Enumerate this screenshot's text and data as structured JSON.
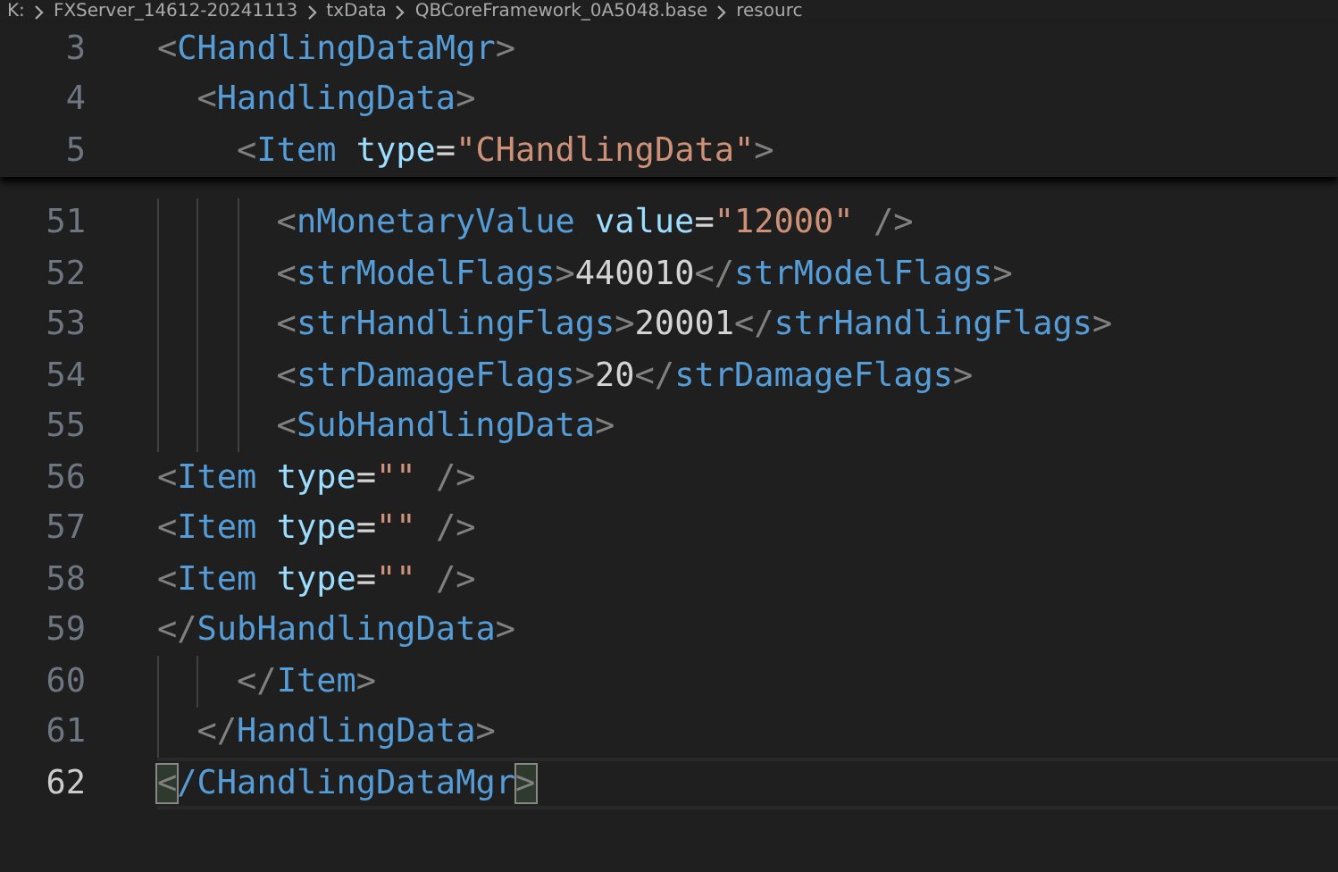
{
  "breadcrumb": [
    "K:",
    "FXServer_14612-20241113",
    "txData",
    "QBCoreFramework_0A5048.base",
    "resourc"
  ],
  "sticky_lines": [
    {
      "number": "3",
      "current": false,
      "tokens": [
        {
          "kind": "punct",
          "text": "<"
        },
        {
          "kind": "tag",
          "text": "CHandlingDataMgr"
        },
        {
          "kind": "punct",
          "text": ">"
        }
      ]
    },
    {
      "number": "4",
      "current": false,
      "guides": [
        false
      ],
      "tokens": [
        {
          "kind": "punct",
          "text": "<"
        },
        {
          "kind": "tag",
          "text": "HandlingData"
        },
        {
          "kind": "punct",
          "text": ">"
        }
      ]
    },
    {
      "number": "5",
      "current": false,
      "guides": [
        false,
        false
      ],
      "tokens": [
        {
          "kind": "punct",
          "text": "<"
        },
        {
          "kind": "tag",
          "text": "Item"
        },
        {
          "kind": "attr",
          "text": "type"
        },
        {
          "kind": "text",
          "text": "="
        },
        {
          "kind": "string",
          "text": "\"CHandlingData\""
        },
        {
          "kind": "punct",
          "text": ">"
        }
      ]
    }
  ],
  "lines": [
    {
      "number": "51",
      "current": false,
      "guides": [
        true,
        true,
        true
      ],
      "tokens": [
        {
          "kind": "punct",
          "text": "<"
        },
        {
          "kind": "tag",
          "text": "nMonetaryValue"
        },
        {
          "kind": "attr",
          "text": "value"
        },
        {
          "kind": "text",
          "text": "="
        },
        {
          "kind": "string",
          "text": "\"12000\""
        },
        {
          "kind": "selfclose",
          "text": "/>"
        }
      ]
    },
    {
      "number": "52",
      "current": false,
      "guides": [
        true,
        true,
        true
      ],
      "tokens": [
        {
          "kind": "punct",
          "text": "<"
        },
        {
          "kind": "tag",
          "text": "strModelFlags"
        },
        {
          "kind": "punct",
          "text": ">"
        },
        {
          "kind": "text",
          "text": "440010"
        },
        {
          "kind": "punct",
          "text": "</"
        },
        {
          "kind": "tag",
          "text": "strModelFlags"
        },
        {
          "kind": "punct",
          "text": ">"
        }
      ]
    },
    {
      "number": "53",
      "current": false,
      "guides": [
        true,
        true,
        true
      ],
      "tokens": [
        {
          "kind": "punct",
          "text": "<"
        },
        {
          "kind": "tag",
          "text": "strHandlingFlags"
        },
        {
          "kind": "punct",
          "text": ">"
        },
        {
          "kind": "text",
          "text": "20001"
        },
        {
          "kind": "punct",
          "text": "</"
        },
        {
          "kind": "tag",
          "text": "strHandlingFlags"
        },
        {
          "kind": "punct",
          "text": ">"
        }
      ]
    },
    {
      "number": "54",
      "current": false,
      "guides": [
        true,
        true,
        true
      ],
      "tokens": [
        {
          "kind": "punct",
          "text": "<"
        },
        {
          "kind": "tag",
          "text": "strDamageFlags"
        },
        {
          "kind": "punct",
          "text": ">"
        },
        {
          "kind": "text",
          "text": "20"
        },
        {
          "kind": "punct",
          "text": "</"
        },
        {
          "kind": "tag",
          "text": "strDamageFlags"
        },
        {
          "kind": "punct",
          "text": ">"
        }
      ]
    },
    {
      "number": "55",
      "current": false,
      "guides": [
        true,
        true,
        true
      ],
      "tokens": [
        {
          "kind": "punct",
          "text": "<"
        },
        {
          "kind": "tag",
          "text": "SubHandlingData"
        },
        {
          "kind": "punct",
          "text": ">"
        }
      ]
    },
    {
      "number": "56",
      "current": false,
      "tokens": [
        {
          "kind": "punct",
          "text": "<"
        },
        {
          "kind": "tag",
          "text": "Item"
        },
        {
          "kind": "attr",
          "text": "type"
        },
        {
          "kind": "text",
          "text": "="
        },
        {
          "kind": "string",
          "text": "\"\""
        },
        {
          "kind": "selfclose",
          "text": "/>"
        }
      ]
    },
    {
      "number": "57",
      "current": false,
      "tokens": [
        {
          "kind": "punct",
          "text": "<"
        },
        {
          "kind": "tag",
          "text": "Item"
        },
        {
          "kind": "attr",
          "text": "type"
        },
        {
          "kind": "text",
          "text": "="
        },
        {
          "kind": "string",
          "text": "\"\""
        },
        {
          "kind": "selfclose",
          "text": "/>"
        }
      ]
    },
    {
      "number": "58",
      "current": false,
      "tokens": [
        {
          "kind": "punct",
          "text": "<"
        },
        {
          "kind": "tag",
          "text": "Item"
        },
        {
          "kind": "attr",
          "text": "type"
        },
        {
          "kind": "text",
          "text": "="
        },
        {
          "kind": "string",
          "text": "\"\""
        },
        {
          "kind": "selfclose",
          "text": "/>"
        }
      ]
    },
    {
      "number": "59",
      "current": false,
      "tokens": [
        {
          "kind": "punct",
          "text": "</"
        },
        {
          "kind": "tag",
          "text": "SubHandlingData"
        },
        {
          "kind": "punct",
          "text": ">"
        }
      ]
    },
    {
      "number": "60",
      "current": false,
      "guides": [
        true,
        true
      ],
      "tokens": [
        {
          "kind": "punct",
          "text": "</"
        },
        {
          "kind": "tag",
          "text": "Item"
        },
        {
          "kind": "punct",
          "text": ">"
        }
      ]
    },
    {
      "number": "61",
      "current": false,
      "guides": [
        true
      ],
      "tokens": [
        {
          "kind": "punct",
          "text": "</"
        },
        {
          "kind": "tag",
          "text": "HandlingData"
        },
        {
          "kind": "punct",
          "text": ">"
        }
      ]
    },
    {
      "number": "62",
      "current": true,
      "tokens": [
        {
          "kind": "bracket",
          "text": "<"
        },
        {
          "kind": "tag",
          "text": "/CHandlingDataMgr"
        },
        {
          "kind": "bracket",
          "text": ">"
        }
      ]
    }
  ]
}
